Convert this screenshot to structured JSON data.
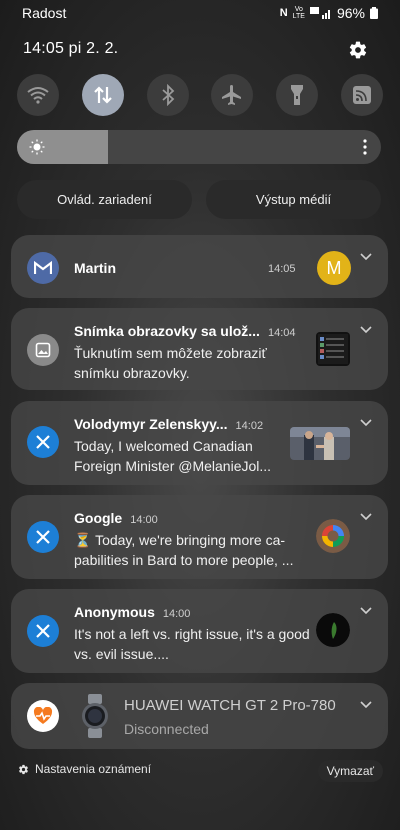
{
  "status_bar": {
    "carrier": "Radost",
    "battery": "96%"
  },
  "header": {
    "datetime": "14:05  pi 2. 2."
  },
  "quick_settings": {
    "tiles": [
      {
        "icon": "wifi-icon",
        "active": false
      },
      {
        "icon": "mobile-data-icon",
        "active": true
      },
      {
        "icon": "bluetooth-icon",
        "active": false
      },
      {
        "icon": "airplane-icon",
        "active": false
      },
      {
        "icon": "flashlight-icon",
        "active": false
      },
      {
        "icon": "cast-icon",
        "active": false
      }
    ],
    "brightness_level": 0.25
  },
  "pills": {
    "device_control": "Ovlád. zariadení",
    "media_output": "Výstup médií"
  },
  "notifications": [
    {
      "app": "Gmail",
      "title": "Martin",
      "time": "14:05",
      "avatar_letter": "M"
    },
    {
      "app": "Gallery",
      "title": "Snímka obrazovky sa ulož...",
      "time": "14:04",
      "body": "Ťuknutím sem môžete zobraziť snímku obrazovky."
    },
    {
      "app": "X",
      "title": "Volodymyr Zelenskyy...",
      "time": "14:02",
      "body": "Today, I welcomed Canadian Foreign Minister @MelanieJol..."
    },
    {
      "app": "X",
      "title": "Google",
      "time": "14:00",
      "body": "⏳ Today, we're bringing more ca-pabilities in Bard to more people, ..."
    },
    {
      "app": "X",
      "title": "Anonymous",
      "time": "14:00",
      "body": "It's not a left vs. right issue, it's a good vs. evil issue...."
    },
    {
      "app": "Huawei Health",
      "title": "HUAWEI WATCH GT 2 Pro-780",
      "body": "Disconnected"
    }
  ],
  "footer": {
    "settings_label": "Nastavenia oznámení",
    "clear_label": "Vymazať"
  },
  "colors": {
    "x_blue": "#1d7fd6",
    "gmail_blue": "#4e6aa6",
    "avatar_yellow": "#e2b318"
  }
}
